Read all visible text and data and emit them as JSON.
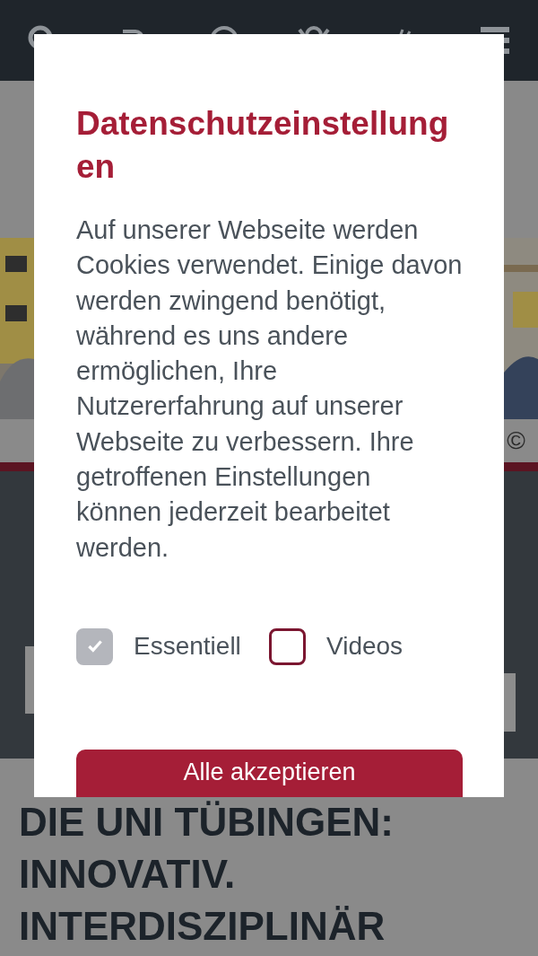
{
  "page": {
    "photo_credit": "©",
    "headline": [
      "DIE UNI TÜBINGEN:",
      "INNOVATIV.",
      "INTERDISZIPLINÄR"
    ]
  },
  "dialog": {
    "title": "Datenschutzeinstellungen",
    "text": "Auf unserer Webseite werden Cookies verwendet. Einige davon werden zwingend benötigt, während es uns andere ermöglichen, Ihre Nutzererfahrung auf unserer Webseite zu verbessern. Ihre getroffenen Einstellungen können jederzeit bearbeitet werden.",
    "options": [
      {
        "label": "Essentiell",
        "checked": true,
        "disabled": true
      },
      {
        "label": "Videos",
        "checked": false,
        "disabled": false
      }
    ],
    "button": "Alle akzeptieren"
  }
}
